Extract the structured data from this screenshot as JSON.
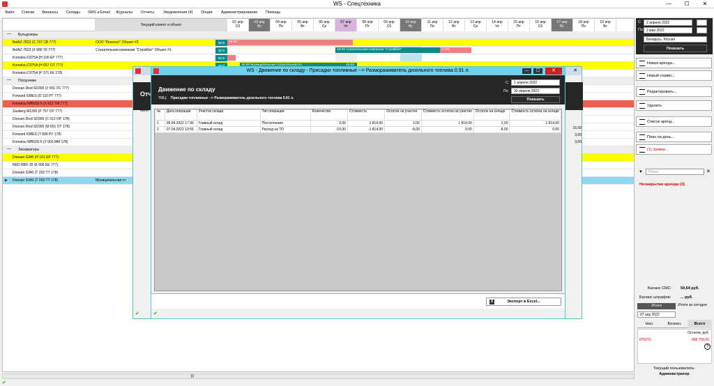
{
  "app": {
    "title": "WS - Спецтехника"
  },
  "menu": [
    "Файл",
    "Списки",
    "Финансы",
    "Склады",
    "SMS и Email",
    "Журналы",
    "Отчеты",
    "Уведомления (4)",
    "Опции",
    "Администрирование",
    "Помощь"
  ],
  "grid": {
    "client_header": "Текущий клиент и объект",
    "days": [
      [
        "02 апр",
        "Сб"
      ],
      [
        "03 апр",
        "Вс"
      ],
      [
        "04 апр",
        "Пн"
      ],
      [
        "05 апр",
        "Вт"
      ],
      [
        "06 апр",
        "Ср"
      ],
      [
        "07 апр",
        "Чт"
      ],
      [
        "08 апр",
        "Пт"
      ],
      [
        "09 апр",
        "Сб"
      ],
      [
        "10 апр",
        "Вс"
      ],
      [
        "11 апр",
        "Пн"
      ],
      [
        "12 апр",
        "Вт"
      ],
      [
        "13 апр",
        "Ср"
      ],
      [
        "14 апр",
        "Чт"
      ],
      [
        "15 апр",
        "Пт"
      ],
      [
        "16 апр",
        "Сб"
      ],
      [
        "17 апр",
        "Вс"
      ],
      [
        "18 апр",
        "Пн"
      ],
      [
        "19 апр",
        "Вт"
      ]
    ],
    "rows": [
      {
        "g": "Бульдозеры"
      },
      {
        "n": "BelAZ-7823 (С 797 СВ 777)",
        "c": "ООО \"Резолют\"  Объект #3",
        "msk": "МСК",
        "hl": "y"
      },
      {
        "n": "BelAZ-7823 (Х 980 ТК 777)",
        "c": "Строительная компания \"Стройбат\"   Объект #1",
        "msk": "МСК"
      },
      {
        "n": "Komatsu D375A (Н 100 ЕР 777)",
        "msk": "МСК"
      },
      {
        "n": "Komatsu D375A (Н 657 ОТ 777)",
        "msk": "МСК",
        "hl": "y"
      },
      {
        "n": "Komatsu D375A (Р 371 ЕК 178)"
      },
      {
        "g": "Погрузчики"
      },
      {
        "n": "Doosan Disd SD300 (У 901 УС 777)"
      },
      {
        "n": "Forward 638ES (О 110 РТ 777)"
      },
      {
        "n": "Komatsu WB93S-5 (Х 812 ТМ 777)",
        "hl": "r"
      },
      {
        "n": "Zauberg M1250 (Р 757 СР 777)"
      },
      {
        "n": "Doosan Disd SD300 (С 012 ОР 178)"
      },
      {
        "n": "Doosan Disd SD300 (М 651 ОТ 178)"
      },
      {
        "n": "Forward 638ES (Т 899 РУ 178)"
      },
      {
        "n": "Komatsu WB93S-5 (У 003 ММ 178)"
      },
      {
        "g": "Экскаваторы"
      },
      {
        "n": "Doosan S340 (Н 101 ЕР 777)",
        "hl": "y"
      },
      {
        "n": "RED RBX-15 (Е 606 ЕЕ 777)"
      },
      {
        "n": "Doosan S340 (Т 202 ТТ 178)"
      },
      {
        "n": "Doosan S340 (Т 203 ТТ 178)",
        "c": "Муниципальная ст",
        "hl": "b"
      }
    ],
    "bar1": "15:00",
    "bar2": "15:00 Строительная компания \"Стройбат\"",
    "bar3": "17:00",
    "bar4": "15:00 Муниципальная строительная ко",
    "bar4b": "15:00",
    "bar5": "10:00"
  },
  "right": {
    "from_label": "С:",
    "from": "2  апреля  2022",
    "to_label": "По:",
    "to": "2    мая   2022",
    "country": "Беларусь, Россия",
    "show": "Показать",
    "buttons": [
      "Новая аренда...",
      "Новый сервис...",
      "Редактировать...",
      "Удалить",
      "Список аренд...",
      "План на день...",
      "(1) Заявки..."
    ],
    "search_placeholder": "Поиск",
    "unclosed": "Незакрытая аренда (3)",
    "sms_label": "Баланс СМС:",
    "sms": "54,54 руб.",
    "fines_label": "Баланс штрафов:",
    "fines": "... руб.",
    "totals": "Итоги",
    "totals_today": "Итоги за сегодня",
    "date": "07 апр  2022",
    "tabs": [
      "Нал.",
      "Безнал.",
      "Всего"
    ],
    "rest_label": "Остаток, руб.",
    "itogo": "ИТОГО",
    "itogo_val": "-998 700,00",
    "user_label": "Текущий пользователь:",
    "user": "Администратор"
  },
  "dialog_back": {
    "title_part": "Отч",
    "kat": "Катег",
    "vals": [
      "15,00",
      "3,00",
      "3,00"
    ]
  },
  "dialog": {
    "title": "WS - Движение по складу - Присадки топливные --> Размораживатель дизельного топлива 0.91 л.",
    "heading": "Движение по складу",
    "tmc_label": "ТМЦ:",
    "tmc": "Присадки топливные --> Размораживатель дизельного топлива 0.91 л.",
    "from_label": "С:",
    "from": "1    апреля    2022",
    "to_label": "По:",
    "to": "30  апреля  2022",
    "show": "Показать",
    "columns": [
      "№",
      "Дата операции",
      "Участок склада",
      "Тип операции",
      "Количество",
      "Стоимость",
      "Остаток на участке",
      "Стоимость остатка на участке",
      "Остаток на складе",
      "Стоимость остатка на складе"
    ],
    "rows": [
      [
        "1",
        "05.04.2022 17:30",
        "Главный склад",
        "Поступление",
        "2,00",
        "1 814,00",
        "2,00",
        "1 814,00",
        "2,00",
        "1 814,00"
      ],
      [
        "2",
        "07.04.2022 13:55",
        "Главный склад",
        "Расход на ТО",
        "-10,00",
        "-1 814,00",
        "-8,00",
        "0,00",
        "-8,00",
        "0,00"
      ]
    ],
    "export": "Экспорт в Excel..."
  }
}
